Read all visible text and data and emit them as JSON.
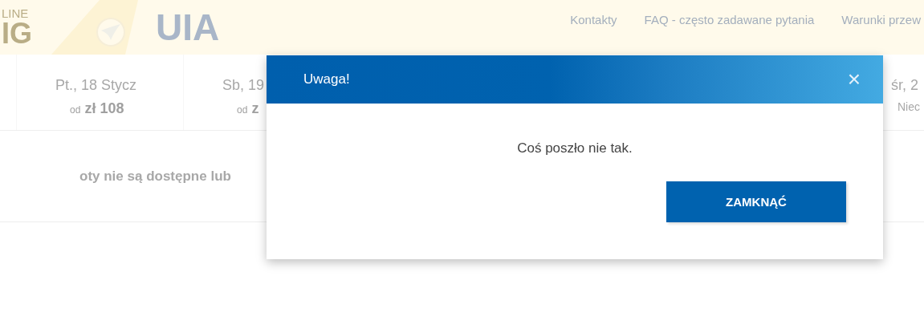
{
  "header": {
    "logo": {
      "lines": [
        "LINE",
        "IG"
      ],
      "name": "UIA"
    },
    "nav": [
      "Kontakty",
      "FAQ - często zadawane pytania",
      "Warunki przew"
    ]
  },
  "dates": [
    {
      "date": "Pt., 18 Stycz",
      "prefix": "od",
      "price": "zł 108"
    },
    {
      "date": "Sb, 19",
      "prefix": "od",
      "price": "z"
    },
    {
      "date": "śr, 2",
      "note": "Niec"
    }
  ],
  "notice": "oty nie są dostępne lub",
  "dialog": {
    "title": "Uwaga!",
    "close": "×",
    "message": "Coś poszło nie tak.",
    "button": "ZAMKNĄĆ"
  }
}
